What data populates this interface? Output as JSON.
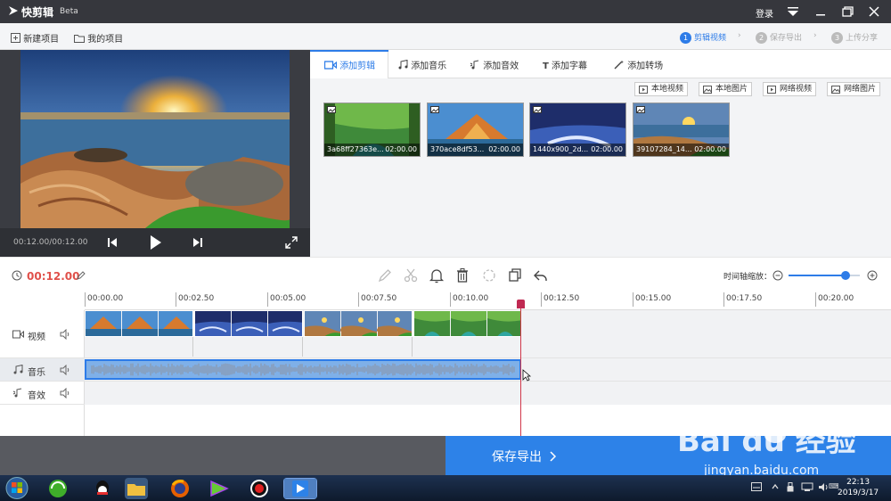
{
  "app": {
    "name": "快剪辑",
    "badge": "Beta",
    "login": "登录"
  },
  "toolbar": {
    "new_project": "新建项目",
    "my_projects": "我的项目",
    "steps": [
      {
        "num": "1",
        "label": "剪辑视频",
        "active": true
      },
      {
        "num": "2",
        "label": "保存导出",
        "active": false
      },
      {
        "num": "3",
        "label": "上传分享",
        "active": false
      }
    ]
  },
  "preview": {
    "timecode": "00:12.00/00:12.00"
  },
  "media_tabs": [
    "添加剪辑",
    "添加音乐",
    "添加音效",
    "添加字幕",
    "添加转场"
  ],
  "media_sources": [
    "本地视频",
    "本地图片",
    "网络视频",
    "网络图片"
  ],
  "media_items": [
    {
      "name": "3a68ff27363e...",
      "duration": "02:00.00"
    },
    {
      "name": "370ace8df53...",
      "duration": "02:00.00"
    },
    {
      "name": "1440x900_2d...",
      "duration": "02:00.00"
    },
    {
      "name": "39107284_14...",
      "duration": "02:00.00"
    }
  ],
  "timeline": {
    "duration": "00:12.00",
    "zoom_label": "时间轴缩放：",
    "zoom_level": 0.8,
    "ruler": [
      "00:00.00",
      "00:02.50",
      "00:05.00",
      "00:07.50",
      "00:10.00",
      "00:12.50",
      "00:15.00",
      "00:17.50",
      "00:20.00"
    ],
    "tracks": {
      "video": "视频",
      "music": "音乐",
      "sfx": "音效"
    }
  },
  "export": {
    "label": "保存导出"
  },
  "taskbar": {
    "time": "22:13",
    "date": "2019/3/17"
  },
  "watermark": {
    "text": "Bai du 经验",
    "url": "jingyan.baidu.com"
  }
}
